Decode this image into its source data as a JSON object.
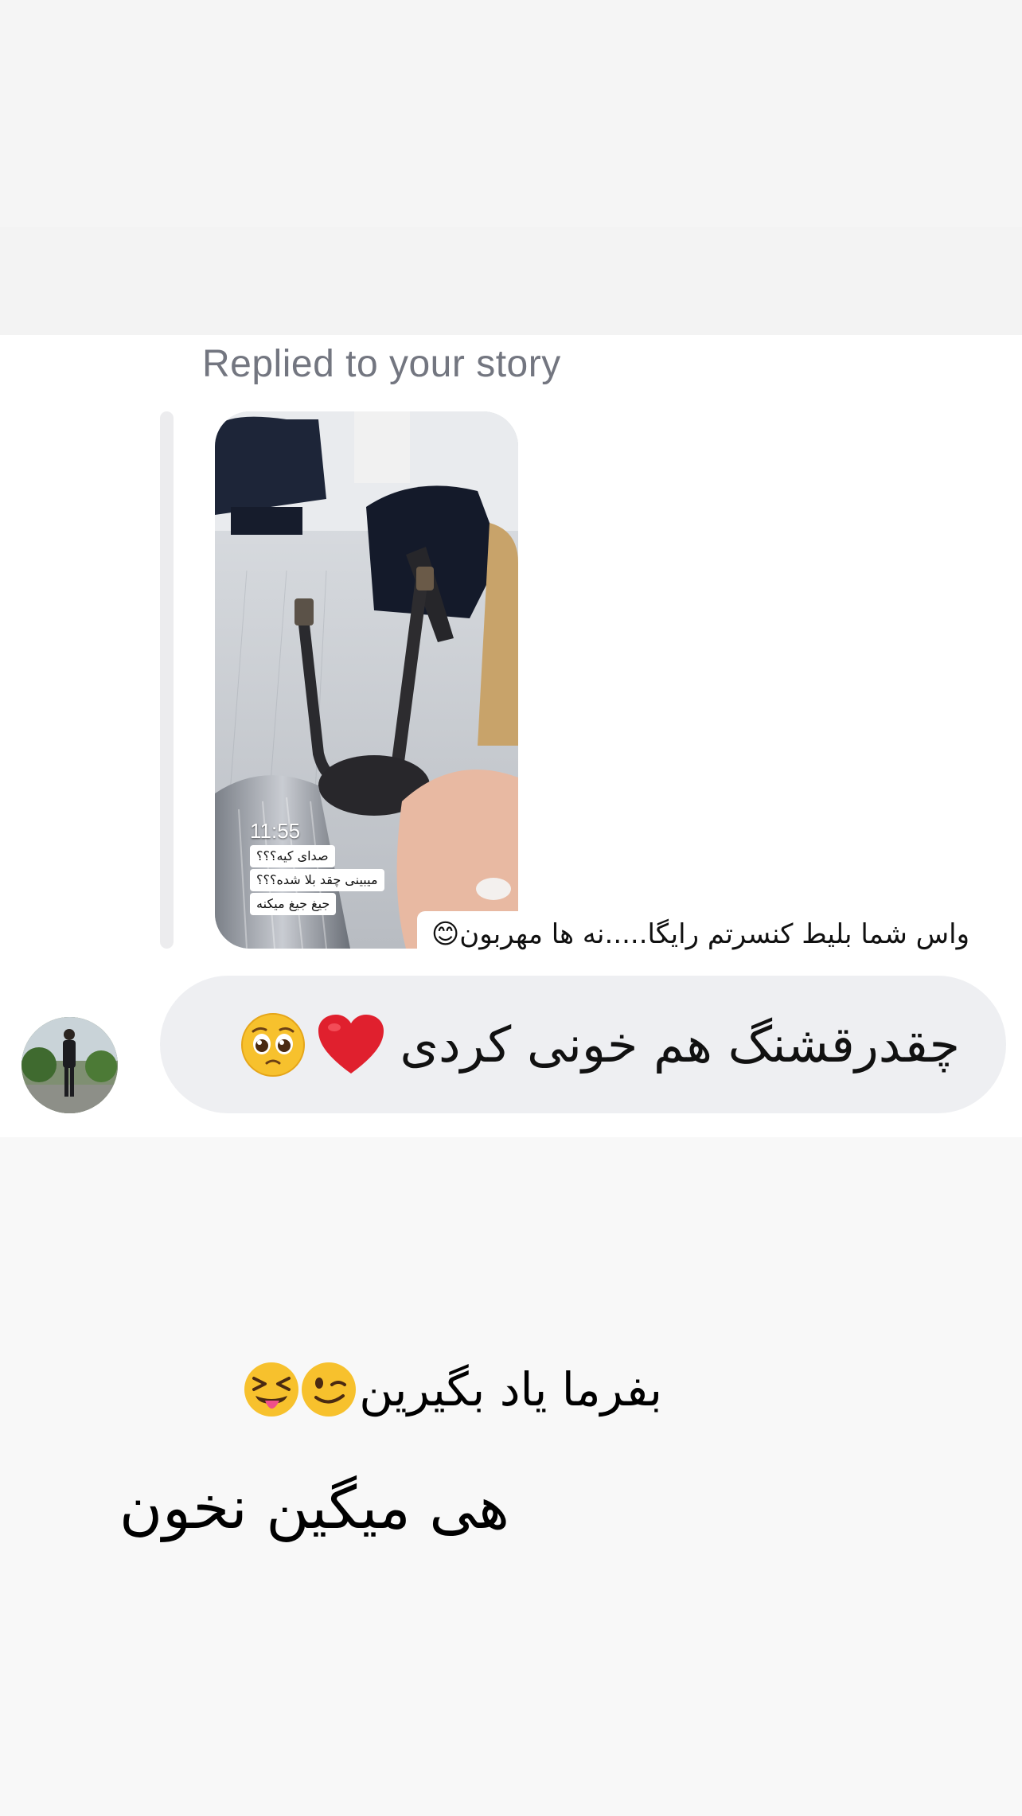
{
  "reply_header": {
    "label": "Replied to your story"
  },
  "story": {
    "time": "11:55",
    "tags": [
      "صدای کیه؟؟؟",
      "میبینی چقد بلا شده؟؟؟",
      "جیغ جیغ میکنه"
    ],
    "caption": "واس شما بلیط کنسرتم رایگا.....نه ها مهربون😊"
  },
  "message": {
    "text": "چقدرقشنگ هم خونی کردی",
    "emojis": [
      "heart-icon",
      "pleading-face-icon"
    ]
  },
  "overlay": {
    "line1": "بفرما یاد بگیرین",
    "line1_emojis": [
      "winking-face-icon",
      "tongue-out-face-icon"
    ],
    "line2": "هی میگین نخون"
  },
  "colors": {
    "bubble_bg": "#eeeff2",
    "label_gray": "#737680",
    "heart_red": "#e0202e",
    "emoji_yellow": "#f7c12d"
  }
}
